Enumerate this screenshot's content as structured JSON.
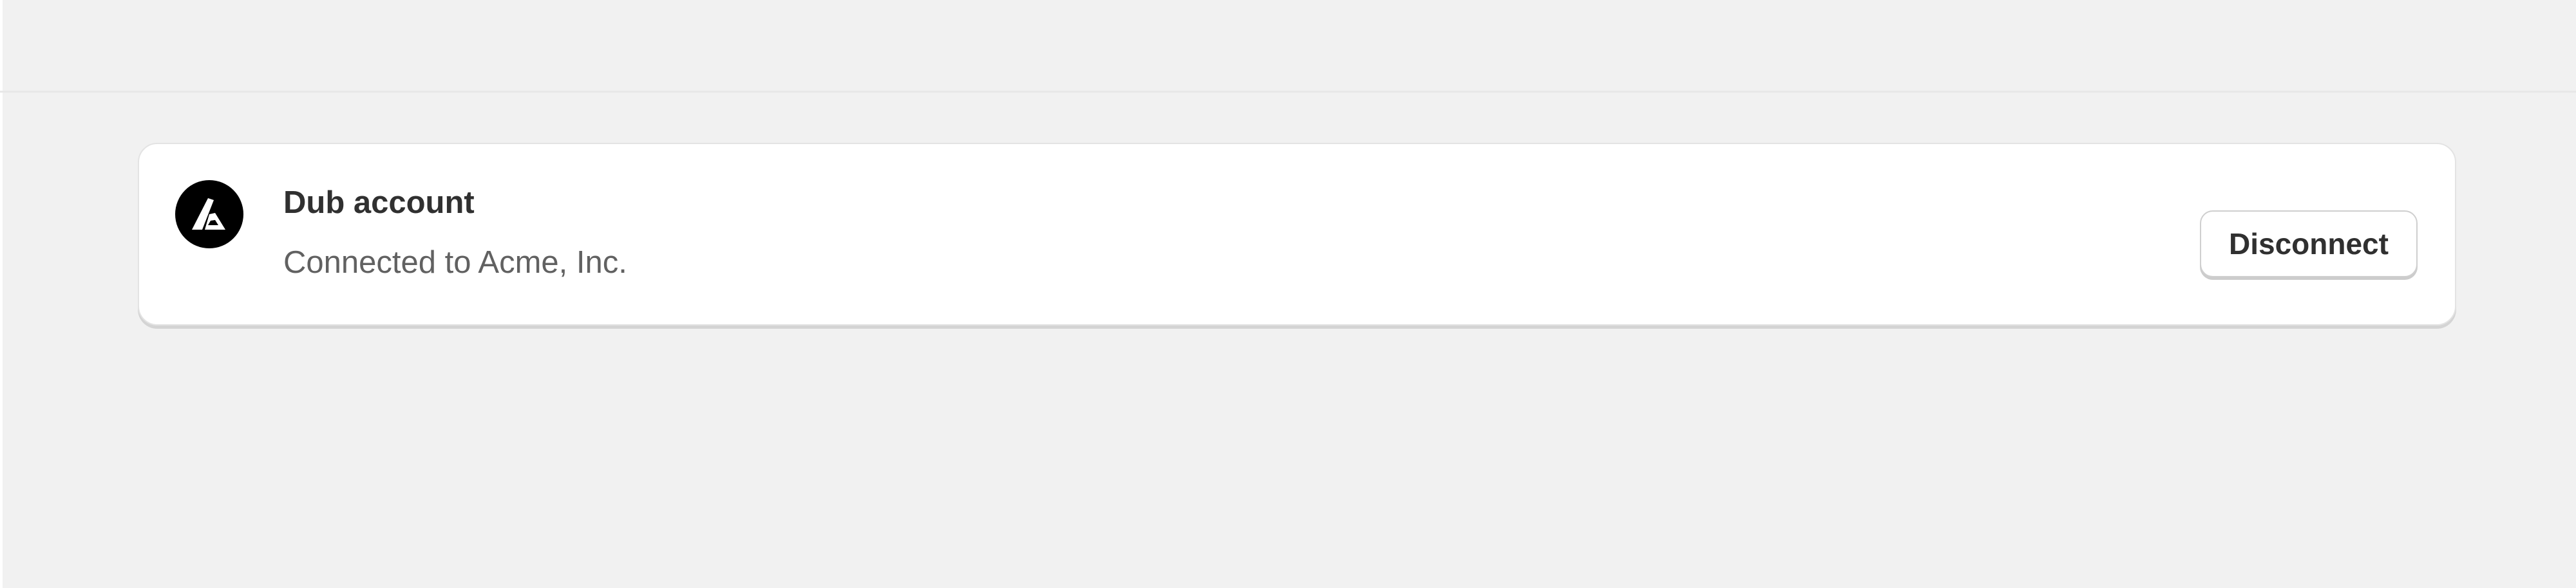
{
  "account": {
    "title": "Dub account",
    "subtitle": "Connected to Acme, Inc.",
    "logo_icon": "dub-logo-icon",
    "disconnect_label": "Disconnect"
  },
  "colors": {
    "background": "#f1f1f1",
    "card": "#ffffff",
    "logo_background": "#000000",
    "title_text": "#303030",
    "subtitle_text": "#616161"
  }
}
